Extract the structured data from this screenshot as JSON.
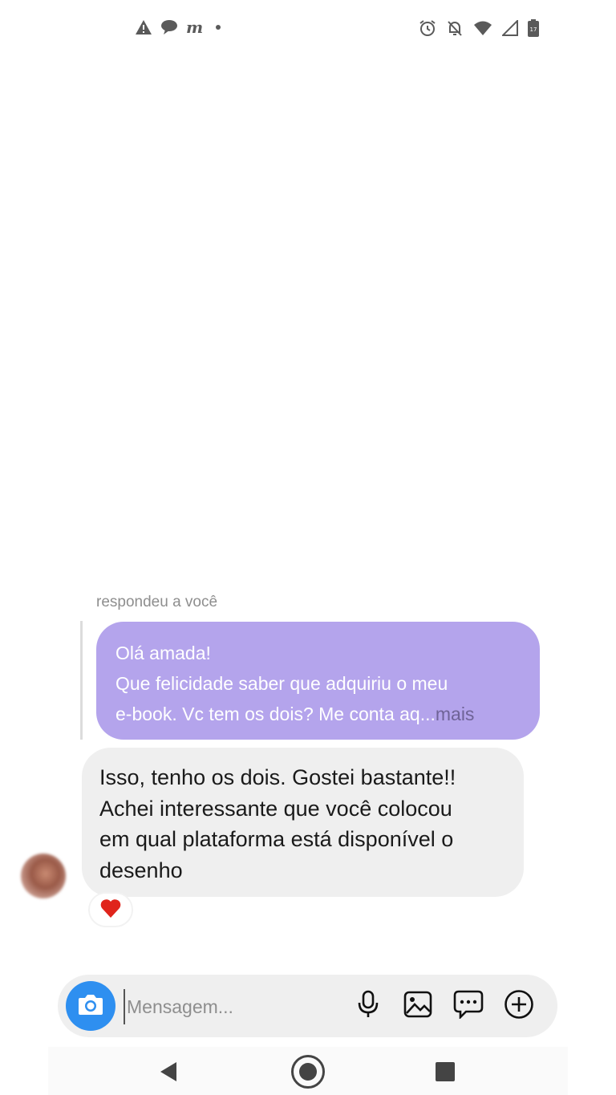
{
  "status_bar": {
    "left_icons": [
      "warning-icon",
      "chat-bubble-icon",
      "m-app-icon",
      "dot-icon"
    ],
    "m_label": "m",
    "right_icons": [
      "alarm-icon",
      "notifications-off-icon",
      "wifi-icon",
      "cell-signal-icon",
      "battery-icon"
    ],
    "battery_level": "17"
  },
  "conversation": {
    "reply_label": "respondeu a você",
    "quoted_message": {
      "line1": "Olá amada!",
      "line2": "Que felicidade saber que adquiriu o meu",
      "line3": "e-book. Vc tem os dois? Me conta aq...",
      "more_label": "mais",
      "bubble_color": "#b4a4ec"
    },
    "message": {
      "line1": "Isso, tenho os dois. Gostei bastante!!",
      "line2": "Achei interessante que você colocou",
      "line3": "em qual plataforma está disponível o",
      "line4": "desenho",
      "bubble_color": "#efefef"
    },
    "reaction": "heart-icon",
    "reaction_color": "#e0241b"
  },
  "composer": {
    "placeholder": "Mensagem...",
    "value": "",
    "camera_color": "#2e8ff0",
    "icons": [
      "microphone-icon",
      "image-icon",
      "sticker-chat-icon",
      "plus-circle-icon"
    ]
  },
  "nav_bar": {
    "buttons": [
      "back-icon",
      "home-icon",
      "recents-icon"
    ]
  }
}
